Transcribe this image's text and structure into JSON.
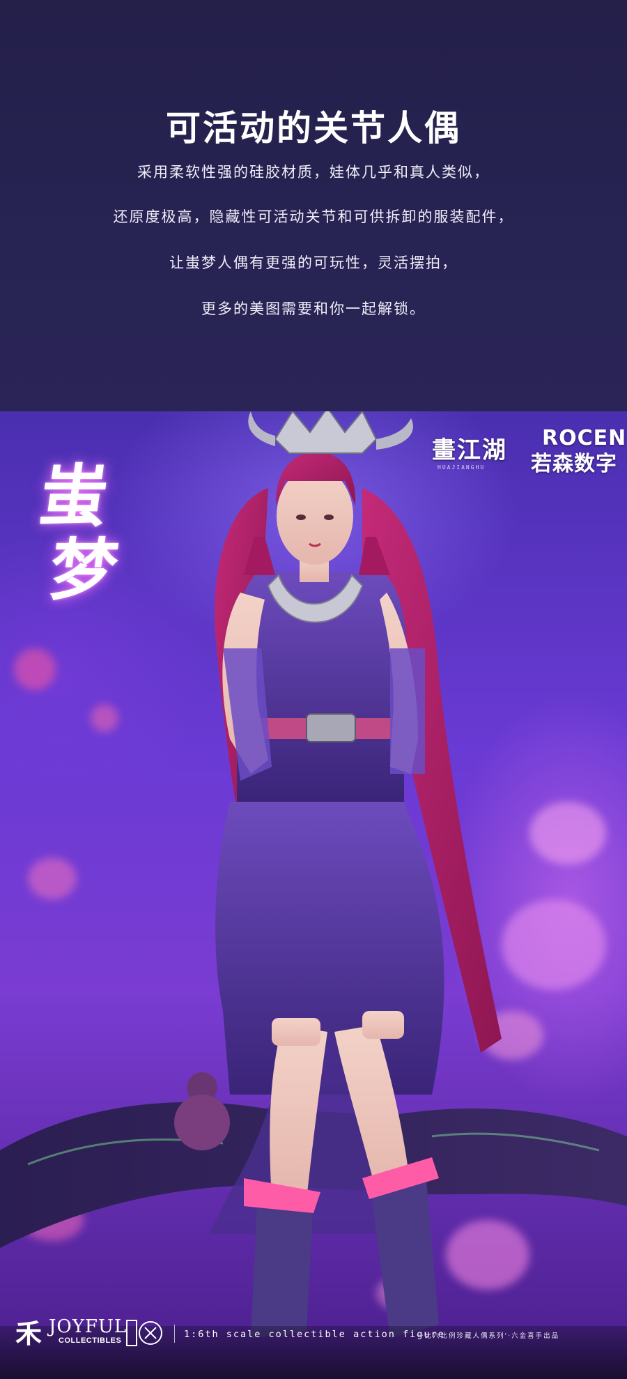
{
  "intro": {
    "title": "可活动的关节人偶",
    "lines": [
      "采用柔软性强的硅胶材质，娃体几乎和真人类似，",
      "还原度极高，隐藏性可活动关节和可供拆卸的服装配件，",
      "让蚩梦人偶有更强的可玩性，灵活摆拍，",
      "更多的美图需要和你一起解锁。"
    ]
  },
  "photo": {
    "character_name": [
      "蚩",
      "梦"
    ],
    "brand_left": {
      "name": "畫江湖",
      "sub": "HUAJIANGHU"
    },
    "brand_right": {
      "name": "ROCEN",
      "name_cn": "若森数字"
    },
    "colors": {
      "hair": "#b8236f",
      "dress": "#5b3aa8",
      "accent_pink": "#ff5ca8",
      "background": "#6a3ad4"
    }
  },
  "footer": {
    "joyful_mark": "禾",
    "joyful_word": "JOYFUL",
    "joyful_sub": "COLLECTIBLES",
    "scale_text": "1:6th scale collectible action figure",
    "series_text": "一比六比例珍藏人偶系列'·六金喜手出品"
  }
}
